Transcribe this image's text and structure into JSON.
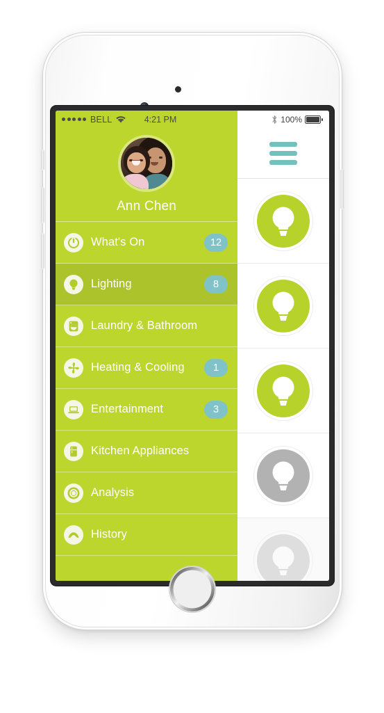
{
  "status_bar": {
    "signal_dots": 5,
    "carrier": "BELL",
    "wifi_icon": "wifi-icon",
    "time": "4:21 PM",
    "bluetooth_icon": "bluetooth-icon",
    "battery_percent": "100%",
    "battery_icon": "battery-full-icon"
  },
  "sidebar": {
    "profile": {
      "avatar_icon": "user-avatar-photo",
      "name": "Ann Chen"
    },
    "items": [
      {
        "label": "What's On",
        "badge": "12",
        "icon": "power-icon"
      },
      {
        "label": "Lighting",
        "badge": "8",
        "icon": "lightbulb-icon",
        "active": true
      },
      {
        "label": "Laundry & Bathroom",
        "badge": "",
        "icon": "washing-machine-icon"
      },
      {
        "label": "Heating & Cooling",
        "badge": "1",
        "icon": "fan-icon"
      },
      {
        "label": "Entertainment",
        "badge": "3",
        "icon": "television-icon"
      },
      {
        "label": "Kitchen Appliances",
        "badge": "",
        "icon": "refrigerator-icon"
      },
      {
        "label": "Analysis",
        "badge": "",
        "icon": "donut-chart-icon"
      },
      {
        "label": "History",
        "badge": "",
        "icon": "history-arc-icon"
      }
    ]
  },
  "right_panel": {
    "menu_icon": "hamburger-menu-icon",
    "bulbs": [
      {
        "state": "on"
      },
      {
        "state": "on"
      },
      {
        "state": "on"
      },
      {
        "state": "off"
      },
      {
        "state": "dim"
      }
    ]
  },
  "device": {
    "speaker_icon": "earpiece-speaker",
    "camera_icon": "front-camera",
    "home_button_icon": "home-button"
  },
  "colors": {
    "brand_green": "#bcd62e",
    "active_green": "#adc32c",
    "badge_teal": "#7fc3c9",
    "menu_teal": "#74c0bd",
    "bulb_on": "#b6d22b",
    "bulb_off": "#b2b2b2"
  }
}
